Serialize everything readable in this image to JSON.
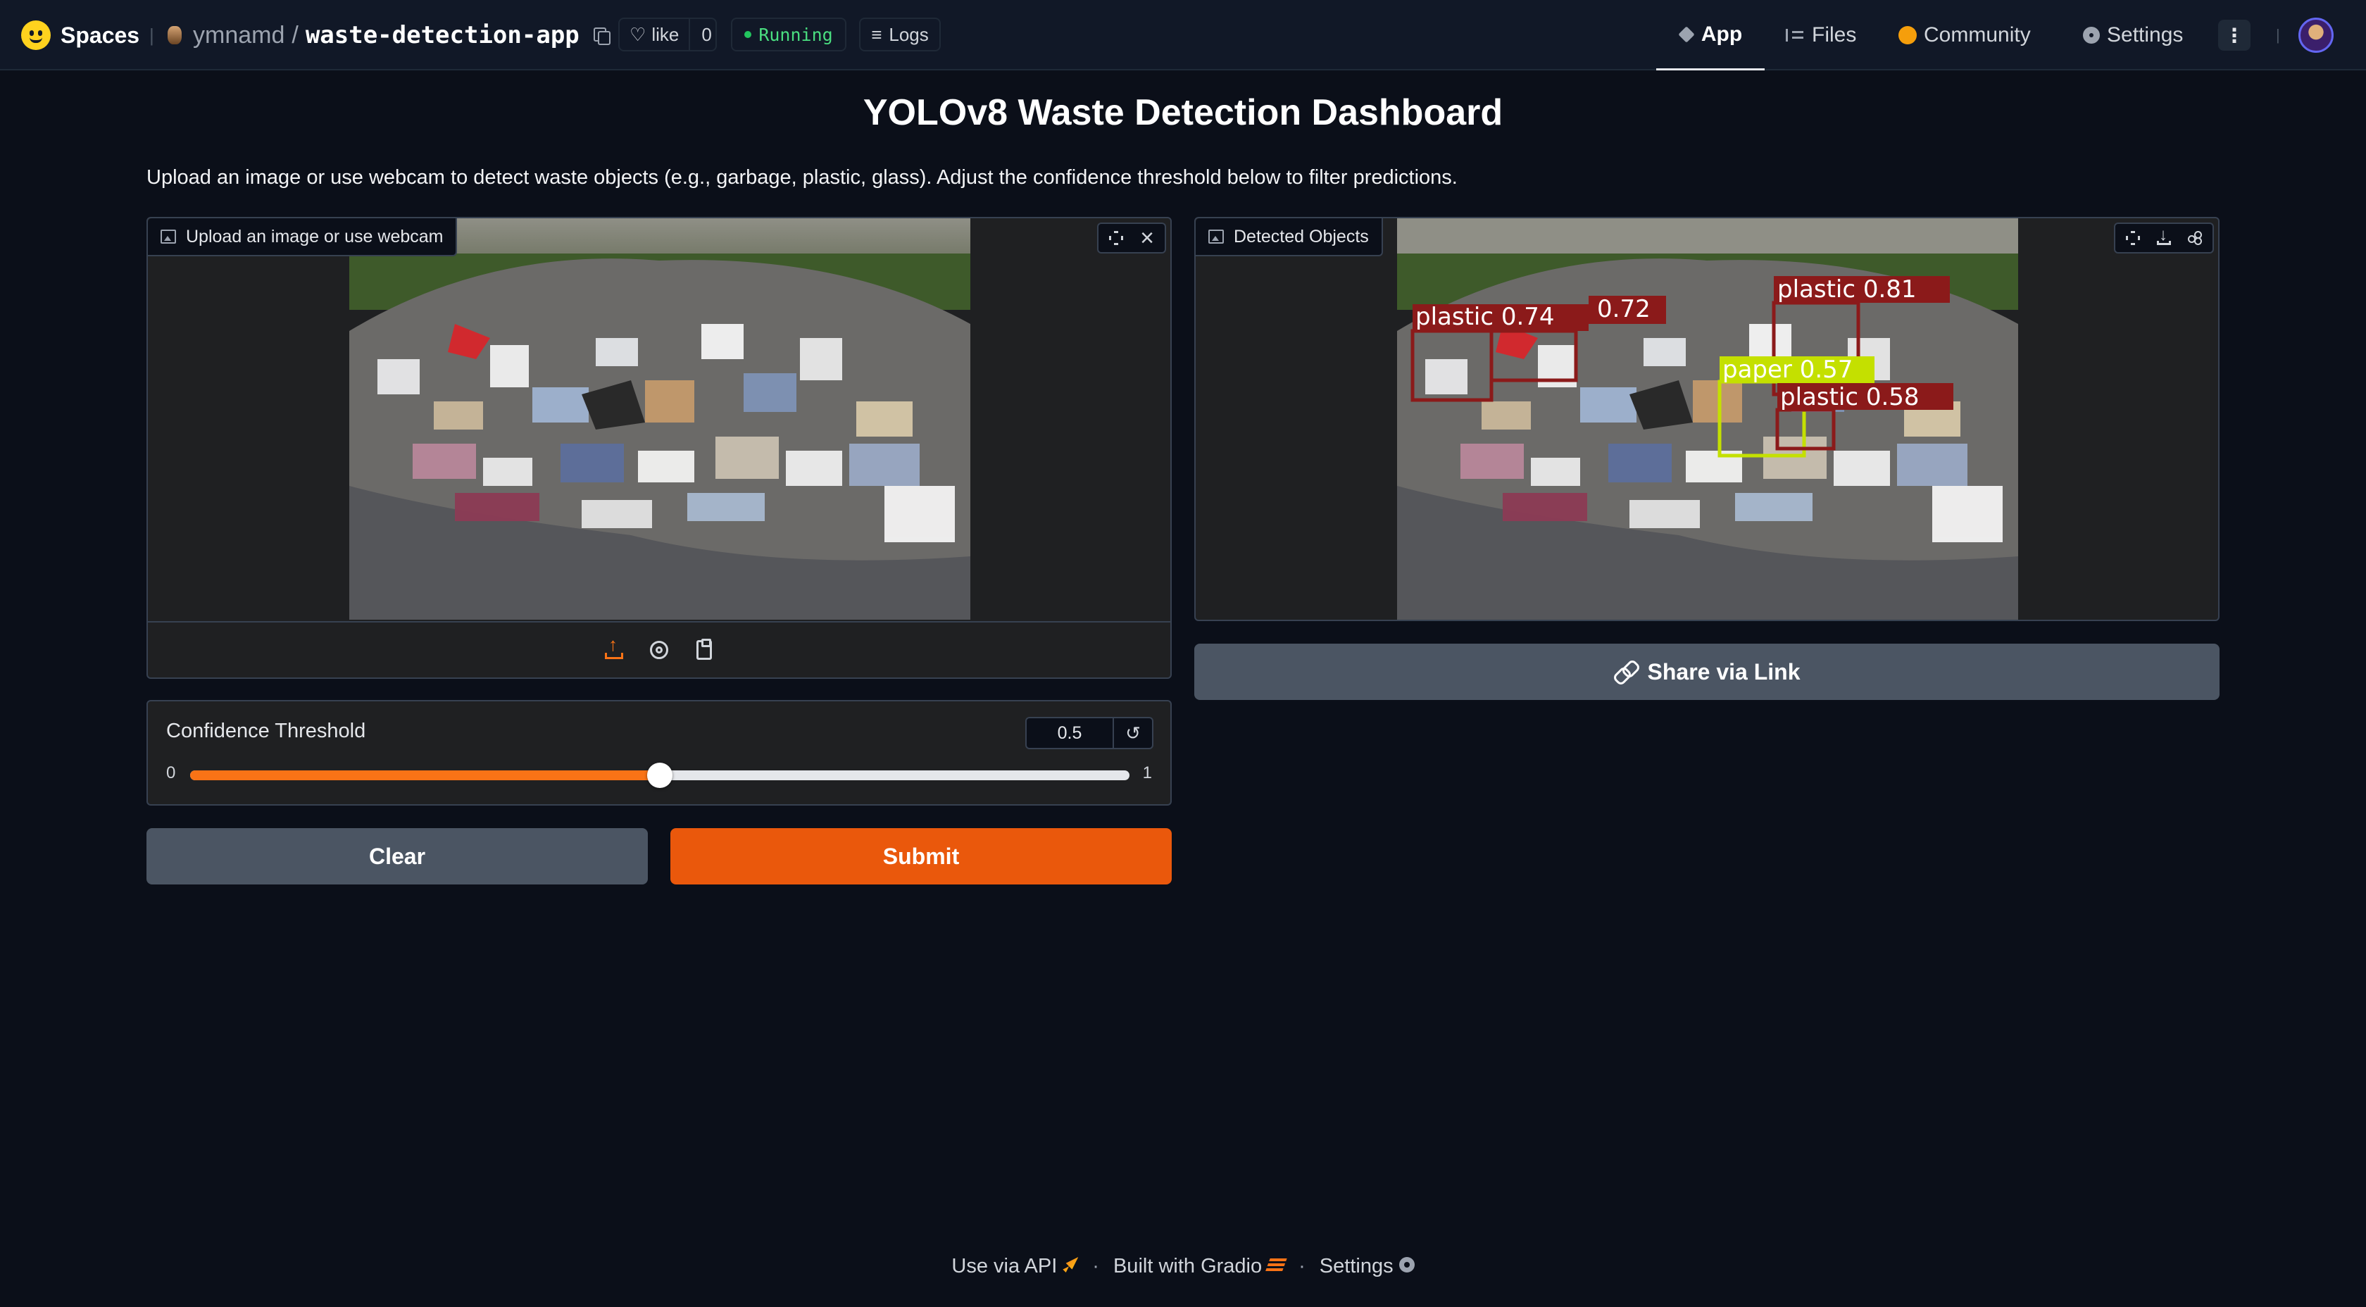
{
  "topbar": {
    "brand": "Spaces",
    "separator": "|",
    "owner": "ymnamd",
    "slash": "/",
    "repo_name": "waste-detection-app",
    "like_label": "like",
    "like_count": "0",
    "status": "Running",
    "logs_label": "Logs",
    "tabs": [
      {
        "label": "App",
        "icon": "cube-icon",
        "active": true
      },
      {
        "label": "Files",
        "icon": "files-icon",
        "active": false
      },
      {
        "label": "Community",
        "icon": "community-icon",
        "active": false
      },
      {
        "label": "Settings",
        "icon": "gear-icon",
        "active": false
      }
    ],
    "more_label": "⋮"
  },
  "page": {
    "title": "YOLOv8 Waste Detection Dashboard",
    "description": "Upload an image or use webcam to detect waste objects (e.g., garbage, plastic, glass). Adjust the confidence threshold below to filter predictions."
  },
  "input_panel": {
    "label": "Upload an image or use webcam",
    "source_buttons": [
      "upload-icon",
      "webcam-icon",
      "clipboard-icon"
    ]
  },
  "output_panel": {
    "label": "Detected Objects",
    "detections": [
      {
        "label": "plastic 0.74",
        "class": "plastic",
        "confidence": 0.74,
        "color": "#8b1a1a"
      },
      {
        "label": "0.72",
        "class": "plastic",
        "confidence": 0.72,
        "color": "#8b1a1a"
      },
      {
        "label": "plastic 0.81",
        "class": "plastic",
        "confidence": 0.81,
        "color": "#8b1a1a"
      },
      {
        "label": "paper 0.57",
        "class": "paper",
        "confidence": 0.57,
        "color": "#c4e000"
      },
      {
        "label": "plastic 0.58",
        "class": "plastic",
        "confidence": 0.58,
        "color": "#8b1a1a"
      }
    ]
  },
  "slider": {
    "label": "Confidence Threshold",
    "value": "0.5",
    "min_label": "0",
    "max_label": "1",
    "fraction": 0.5,
    "reset_icon": "↺"
  },
  "buttons": {
    "clear": "Clear",
    "submit": "Submit",
    "share": "Share via Link"
  },
  "footer": {
    "api": "Use via API",
    "built": "Built with Gradio",
    "settings": "Settings",
    "sep": "·"
  },
  "colors": {
    "background": "#0b0f19",
    "accent": "#ea580c",
    "status_green": "#22c55e"
  }
}
